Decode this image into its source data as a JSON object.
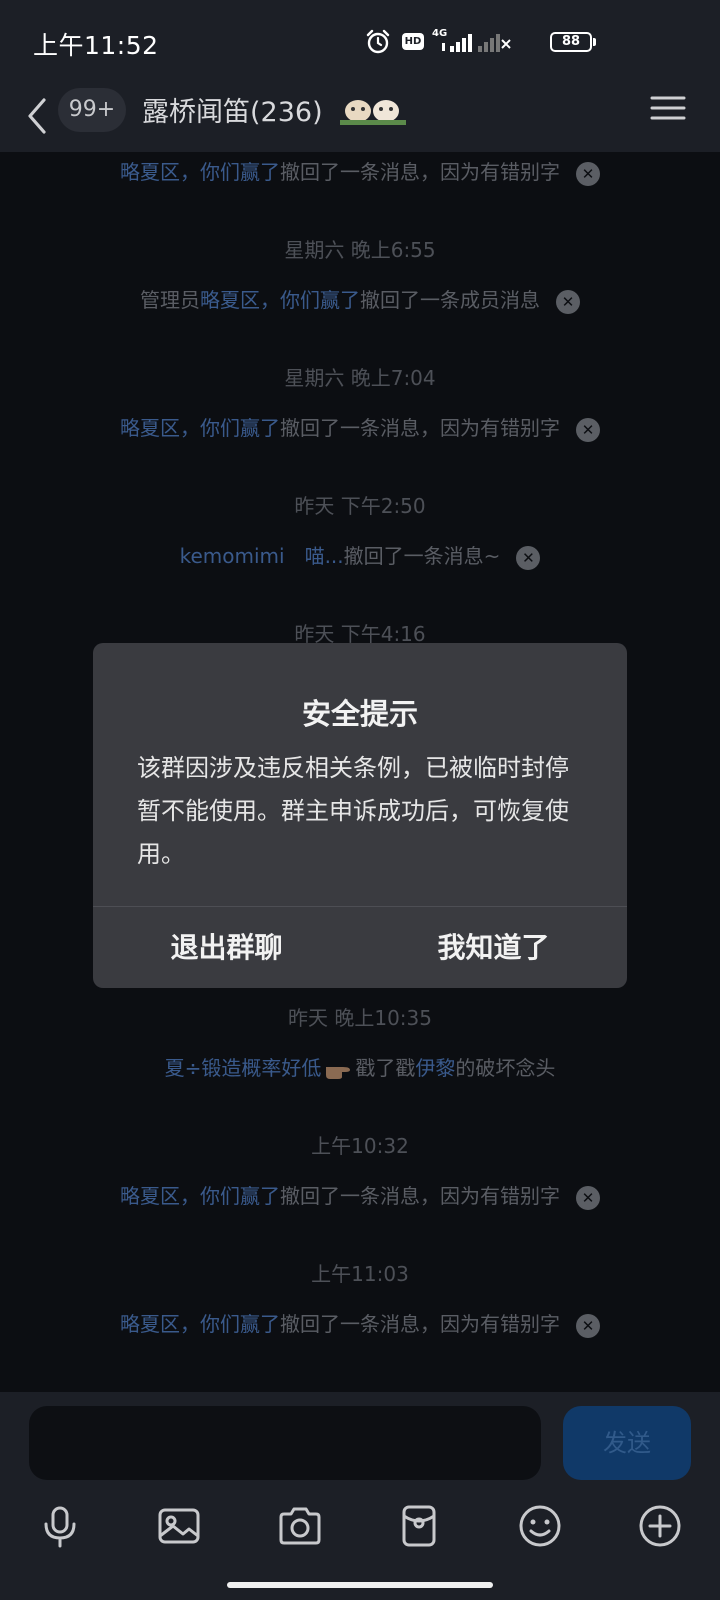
{
  "status_bar": {
    "time": "上午11:52",
    "network": "4G",
    "hd_badge": "HD",
    "battery": "88"
  },
  "header": {
    "unread_count": "99+",
    "group_name": "露桥闻笛(236)"
  },
  "messages": {
    "m1": {
      "user": "略夏区，你们赢了",
      "text": "撤回了一条消息，因为有错别字"
    },
    "t1": "星期六 晚上6:55",
    "m2": {
      "prefix": "管理员",
      "user": "略夏区，你们赢了",
      "text": "撤回了一条成员消息"
    },
    "t2": "星期六 晚上7:04",
    "m3": {
      "user": "略夏区，你们赢了",
      "text": "撤回了一条消息，因为有错别字"
    },
    "t3": "昨天 下午2:50",
    "m4": {
      "user": "kemomimi　喵...",
      "text": "撤回了一条消息~"
    },
    "t4_partial": "昨天 下午4:16",
    "t5": "昨天 晚上10:35",
    "m5": {
      "user": "夏÷锻造概率好低",
      "mid": "戳了戳",
      "target": "伊黎",
      "text": "的破坏念头"
    },
    "t6": "上午10:32",
    "m6": {
      "user": "略夏区，你们赢了",
      "text": "撤回了一条消息，因为有错别字"
    },
    "t7": "上午11:03",
    "m7": {
      "user": "略夏区，你们赢了",
      "text": "撤回了一条消息，因为有错别字"
    }
  },
  "dialog": {
    "title": "安全提示",
    "body": "该群因涉及违反相关条例，已被临时封停暂不能使用。群主申诉成功后，可恢复使用。",
    "exit_label": "退出群聊",
    "ok_label": "我知道了"
  },
  "input": {
    "value": "",
    "send_label": "发送"
  },
  "icons": [
    "alarm-icon",
    "back-icon",
    "menu-icon",
    "close-icon",
    "pointing-hand-icon",
    "mic-icon",
    "image-icon",
    "camera-icon",
    "red-packet-icon",
    "emoji-icon",
    "plus-icon"
  ],
  "colors": {
    "highlight_name": "#3a5a8c",
    "send_button": "#103968",
    "dialog_bg": "#3a3b40"
  }
}
